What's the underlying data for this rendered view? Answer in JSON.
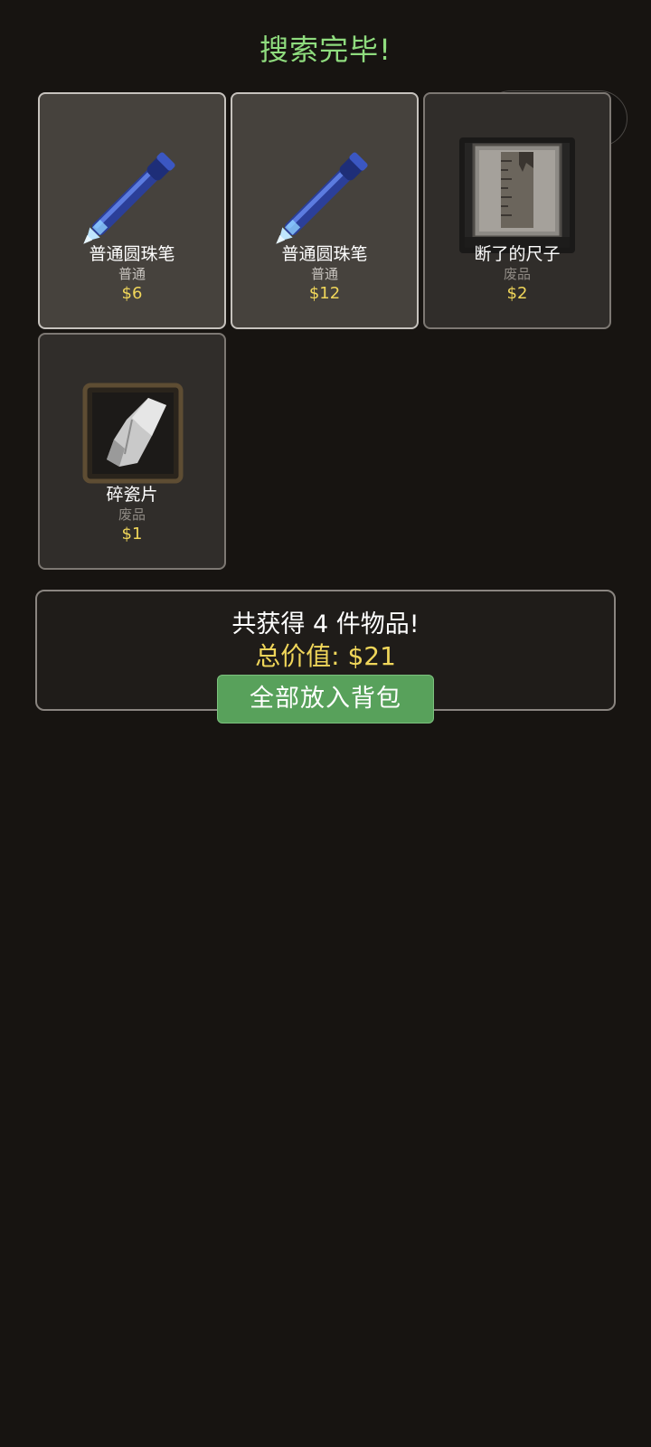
{
  "header": {
    "title": "搜索完毕!"
  },
  "capsule": {
    "more_icon": "more-dots-icon",
    "close_icon": "target-close-icon"
  },
  "items": [
    {
      "name": "普通圆珠笔",
      "rarity": "普通",
      "price": "$6",
      "icon": "ballpoint-pen-icon"
    },
    {
      "name": "普通圆珠笔",
      "rarity": "普通",
      "price": "$12",
      "icon": "ballpoint-pen-icon"
    },
    {
      "name": "断了的尺子",
      "rarity": "废品",
      "price": "$2",
      "icon": "broken-ruler-icon"
    },
    {
      "name": "碎瓷片",
      "rarity": "废品",
      "price": "$1",
      "icon": "porcelain-shard-icon"
    }
  ],
  "summary": {
    "count_text": "共获得 4 件物品!",
    "total_text": "总价值: $21",
    "button_label": "全部放入背包"
  },
  "colors": {
    "title": "#8fdc7e",
    "price": "#f0d65a",
    "button": "#58a15b",
    "background": "#171411"
  }
}
